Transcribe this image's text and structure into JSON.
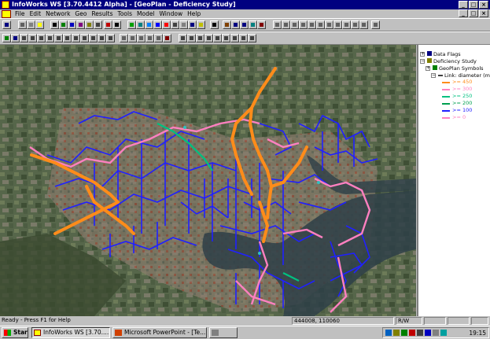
{
  "window": {
    "title": "InfoWorks WS [3.70.4412 Alpha] - [GeoPlan - Deficiency Study]"
  },
  "title_buttons": {
    "min": "_",
    "max": "□",
    "close": "×"
  },
  "menu": [
    "File",
    "Edit",
    "Network",
    "Geo",
    "Results",
    "Tools",
    "Model",
    "Window",
    "Help"
  ],
  "tree": {
    "data_flags": "Data Flags",
    "deficiency": "Deficiency Study",
    "geoplan_symbols": "GeoPlan Symbols",
    "link_diameter": "Link: diameter (mm",
    "legend": [
      {
        "label": ">= 450",
        "color": "#ff8c1a"
      },
      {
        "label": ">= 300",
        "color": "#ff80c0"
      },
      {
        "label": ">= 250",
        "color": "#00c080"
      },
      {
        "label": ">= 200",
        "color": "#00a050"
      },
      {
        "label": ">= 100",
        "color": "#2020ff"
      },
      {
        "label": ">= 0",
        "color": "#ff80c0"
      }
    ]
  },
  "status": {
    "message": "Ready - Press F1 for Help",
    "coords": "444008, 110060",
    "mode": "R/W"
  },
  "taskbar": {
    "start": "Start",
    "tasks": [
      "InfoWorks WS [3.70....",
      "Microsoft PowerPoint - [Te...",
      ""
    ],
    "clock": "19:15"
  }
}
